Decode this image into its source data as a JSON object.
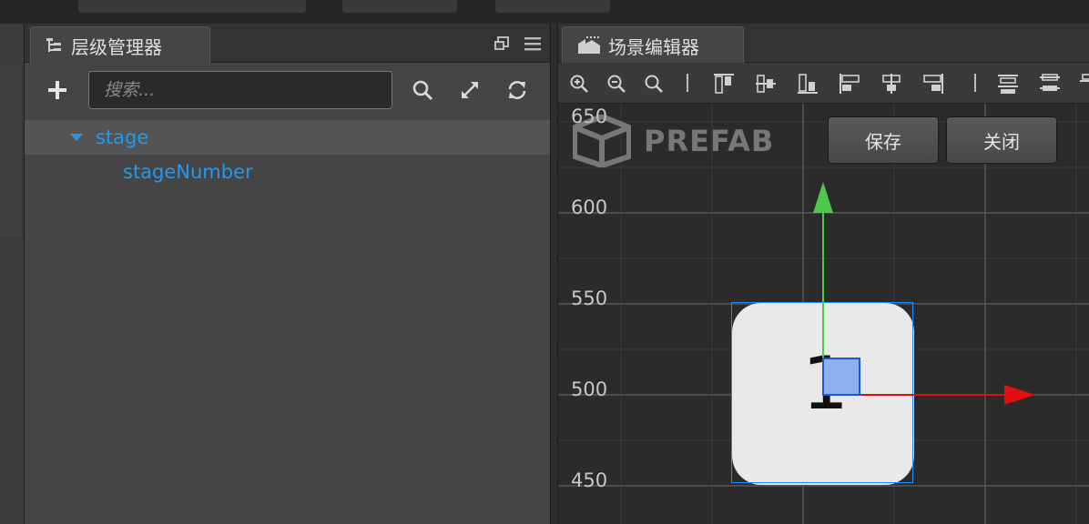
{
  "hierarchy_panel": {
    "tab_title": "层级管理器",
    "search_placeholder": "搜索...",
    "tree": [
      {
        "label": "stage",
        "expanded": true,
        "selected": true
      },
      {
        "label": "stageNumber",
        "child": true
      }
    ]
  },
  "scene_panel": {
    "tab_title": "场景编辑器",
    "prefab_label": "PREFAB",
    "save_button": "保存",
    "close_button": "关闭",
    "y_axis_labels": [
      "650",
      "600",
      "550",
      "500",
      "450"
    ],
    "node_text": "1"
  },
  "colors": {
    "accent_blue": "#1e9bf0",
    "axis_y": "#4cc94c",
    "axis_x": "#e01010",
    "selection": "#1a8cff"
  },
  "icons": {
    "hierarchy_tab": "tree-icon",
    "scene_tab": "scene-icon",
    "add": "plus-icon",
    "search": "search-icon",
    "expand": "expand-icon",
    "refresh": "refresh-icon",
    "popout": "popout-icon",
    "menu": "menu-icon"
  }
}
